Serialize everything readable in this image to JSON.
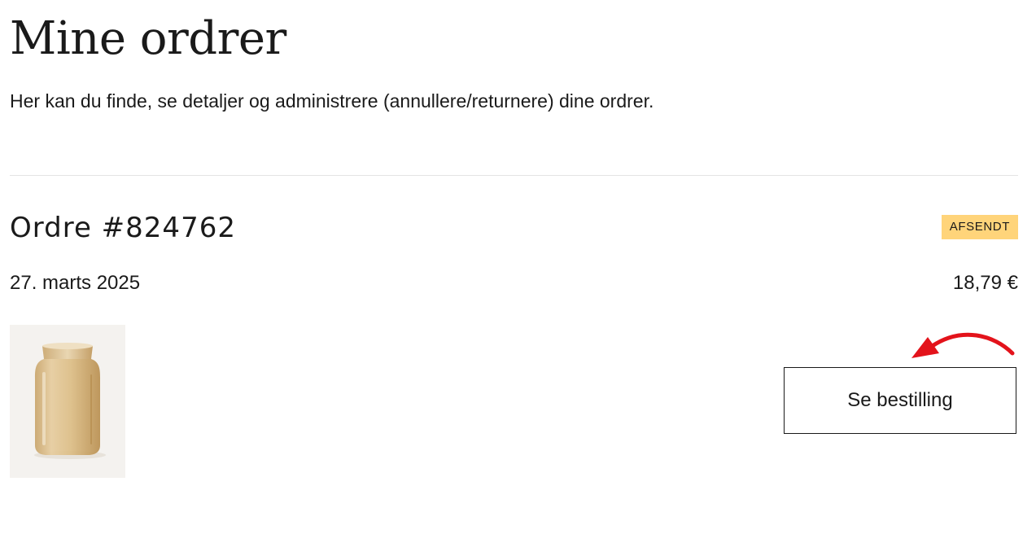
{
  "page": {
    "title": "Mine ordrer",
    "description": "Her kan du finde, se detaljer og administrere (annullere/returnere) dine ordrer."
  },
  "order": {
    "number": "Ordre #824762",
    "status": "AFSENDT",
    "status_color": "#ffd47a",
    "date": "27. marts 2025",
    "total": "18,79 €",
    "product_image": "amber-glass-vase",
    "view_button_label": "Se bestilling"
  },
  "annotation": {
    "icon": "red-arrow-icon",
    "color": "#e3131b"
  }
}
